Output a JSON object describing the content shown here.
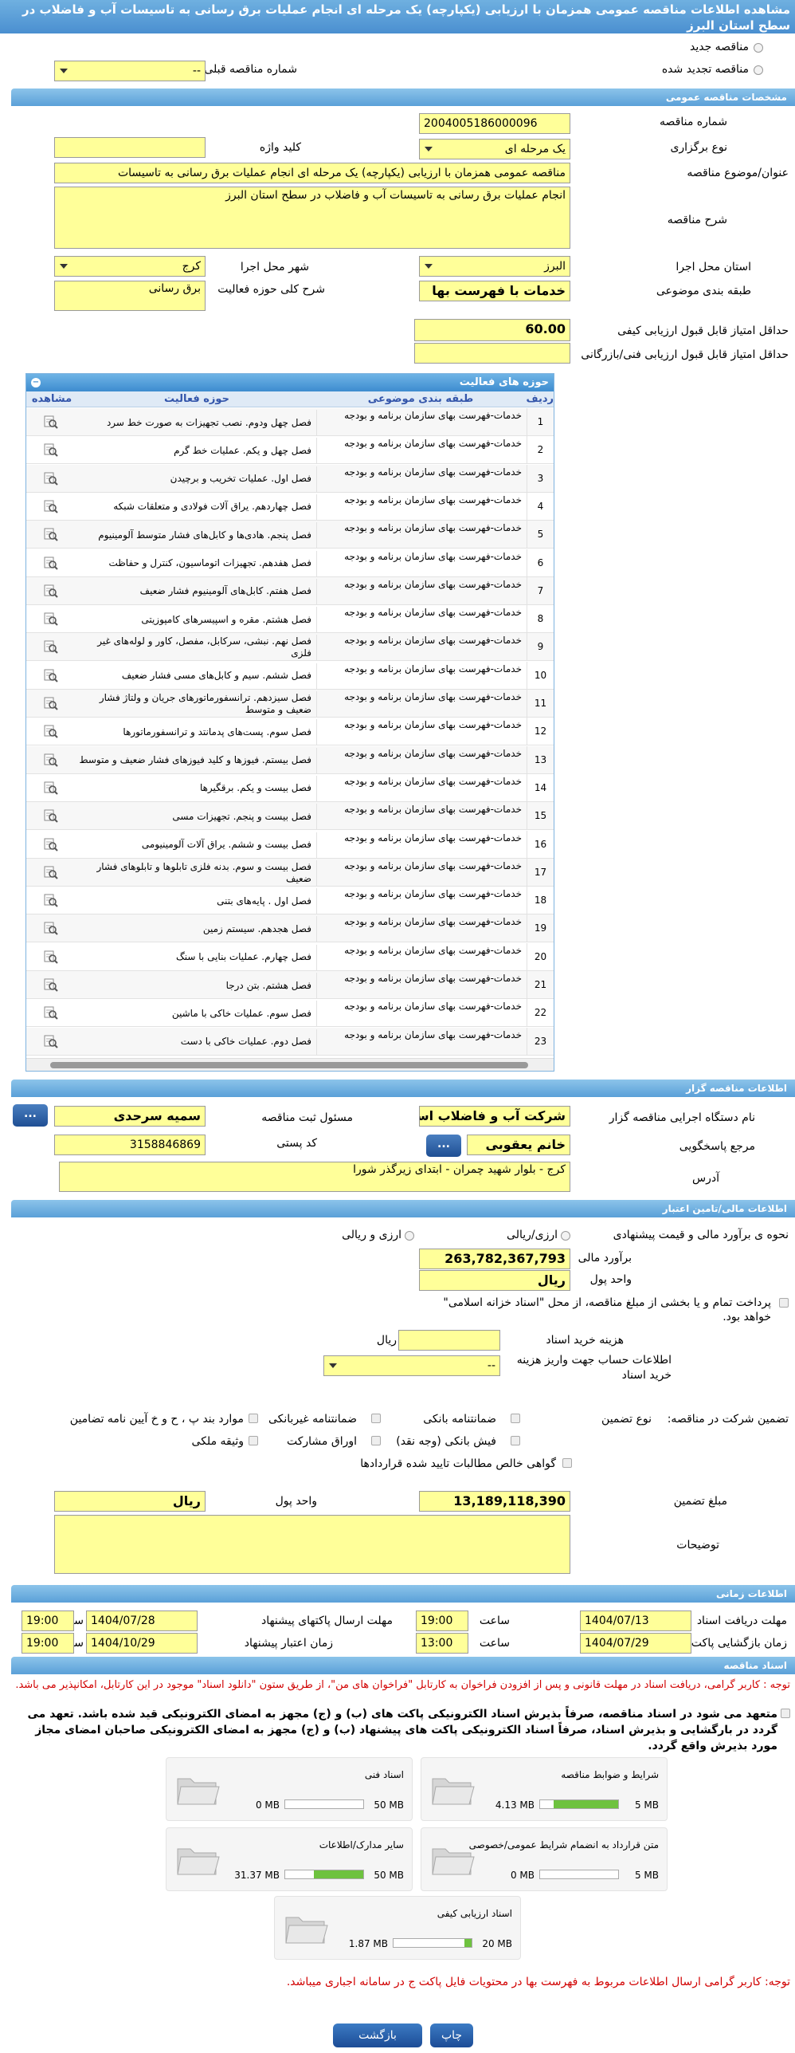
{
  "page": {
    "title": "مشاهده اطلاعات مناقصه عمومی همزمان با ارزیابی (یکپارچه) یک مرحله ای انجام عملیات برق رسانی به تاسیسات آب و فاضلاب در سطح استان البرز"
  },
  "tender_kind": {
    "new_label": "مناقصه جدید",
    "renewed_label": "مناقصه تجدید شده",
    "previous_number_label": "شماره مناقصه قبلی",
    "previous_number_value": "--"
  },
  "general": {
    "section_title": "مشخصات مناقصه عمومی",
    "number_label": "شماره مناقصه",
    "number_value": "2004005186000096",
    "type_label": "نوع برگزاری",
    "type_value": "یک مرحله ای",
    "keyword_label": "کلید واژه",
    "keyword_value": "",
    "subject_label": "عنوان/موضوع مناقصه",
    "subject_value": "مناقصه عمومی همزمان با ارزیابی (یکپارچه) یک مرحله ای انجام عملیات برق رسانی به تاسیسات",
    "description_label": "شرح مناقصه",
    "description_value": "انجام عملیات برق رسانی به تاسیسات آب و فاضلاب در سطح استان البرز",
    "province_label": "استان محل اجرا",
    "province_value": "البرز",
    "city_label": "شهر محل اجرا",
    "city_value": "کرج",
    "category_label": "طبقه بندی موضوعی",
    "category_value": "خدمات با فهرست بها",
    "scope_label": "شرح کلی حوزه فعالیت",
    "scope_value": "برق رسانی",
    "min_quality_label": "حداقل امتیاز قابل قبول ارزیابی کیفی",
    "min_quality_value": "60.00",
    "min_tech_label": "حداقل امتیاز قابل قبول ارزیابی فنی/بازرگانی",
    "min_tech_value": ""
  },
  "activity": {
    "title": "حوزه های فعالیت",
    "col_row": "ردیف",
    "col_category": "طبقه بندی موضوعی",
    "col_activity": "حوزه فعالیت",
    "col_view": "مشاهده",
    "category_text": "خدمات-فهرست بهای سازمان برنامه و بودجه",
    "rows": [
      {
        "n": "1",
        "act": "فصل چهل ودوم. نصب تجهیزات به صورت خط سرد"
      },
      {
        "n": "2",
        "act": "فصل چهل و یکم. عملیات خط گرم"
      },
      {
        "n": "3",
        "act": "فصل اول. عملیات تخریب و برچیدن"
      },
      {
        "n": "4",
        "act": "فصل چهاردهم. یراق آلات فولادی و متعلقات شبکه"
      },
      {
        "n": "5",
        "act": "فصل پنجم. هادی‌ها و کابل‌های فشار متوسط آلومینیوم"
      },
      {
        "n": "6",
        "act": "فصل هفدهم. تجهیزات اتوماسیون، کنترل و حفاظت"
      },
      {
        "n": "7",
        "act": "فصل هفتم. کابل‌های آلومینیوم فشار ضعیف"
      },
      {
        "n": "8",
        "act": "فصل هشتم. مقره و اسپیسرهای کامپوزیتی"
      },
      {
        "n": "9",
        "act": "فصل نهم. نبشی، سرکابل، مفصل، کاور و لوله‌های غیر فلزی"
      },
      {
        "n": "10",
        "act": "فصل ششم. سیم و کابل‌های مسی فشار ضعیف"
      },
      {
        "n": "11",
        "act": "فصل سیزدهم. ترانسفورماتورهای جریان و ولتاژ فشار ضعیف و متوسط"
      },
      {
        "n": "12",
        "act": "فصل سوم. پست‌های پدمانتد و ترانسفورماتورها"
      },
      {
        "n": "13",
        "act": "فصل بیستم. فیوزها و کلید فیوزهای فشار ضعیف و متوسط"
      },
      {
        "n": "14",
        "act": "فصل بیست و یکم. برقگیرها"
      },
      {
        "n": "15",
        "act": "فصل بیست و پنجم. تجهیزات مسی"
      },
      {
        "n": "16",
        "act": "فصل بیست و ششم. یراق آلات آلومینیومی"
      },
      {
        "n": "17",
        "act": "فصل بیست و سوم. بدنه فلزی تابلوها و تابلوهای فشار ضعیف"
      },
      {
        "n": "18",
        "act": "فصل اول . پایه‌های بتنی"
      },
      {
        "n": "19",
        "act": "فصل هجدهم. سیستم زمین"
      },
      {
        "n": "20",
        "act": "فصل چهارم. عملیات بنایی با سنگ"
      },
      {
        "n": "21",
        "act": "فصل هشتم. بتن درجا"
      },
      {
        "n": "22",
        "act": "فصل سوم. عملیات خاکی با ماشین"
      },
      {
        "n": "23",
        "act": "فصل دوم. عملیات خاکی با دست"
      }
    ]
  },
  "organizer": {
    "section_title": "اطلاعات مناقصه گزار",
    "org_label": "نام دستگاه اجرایی مناقصه گزار",
    "org_value": "شرکت آب و فاضلاب استان",
    "registrar_label": "مسئول ثبت مناقصه",
    "registrar_value": "سمیه سرحدی",
    "reference_label": "مرجع پاسخگویی",
    "reference_value": "خانم یعقوبی",
    "postal_label": "کد پستی",
    "postal_value": "3158846869",
    "address_label": "آدرس",
    "address_value": "کرج - بلوار شهید چمران - ابتدای زیرگذر شورا",
    "dots": "..."
  },
  "financial": {
    "section_title": "اطلاعات مالی/تامین اعتبار",
    "estimate_method_label": "نحوه ی برآورد مالی و قیمت پیشنهادی",
    "rial_label": "ارزی/ریالی",
    "fx_label": "ارزی و ریالی",
    "estimate_label": "برآورد مالی",
    "estimate_value": "263,782,367,793",
    "currency_label": "واحد پول",
    "currency_value": "ریال",
    "treasury_text": "پرداخت تمام و یا بخشی از مبلغ مناقصه، از محل \"اسناد خزانه اسلامی\" خواهد بود.",
    "doc_fee_label": "هزینه خرید اسناد",
    "doc_fee_value": "",
    "doc_fee_unit": "ریال",
    "account_label": "اطلاعات حساب جهت واریز هزینه خرید اسناد",
    "account_value": "--",
    "guarantee_label": "تضمین شرکت در مناقصه:",
    "guarantee_type_label": "نوع تضمین",
    "g1": "ضمانتنامه بانکی",
    "g2": "ضمانتنامه غیربانکی",
    "g3": "موارد بند پ ، ح و خ آیین نامه تضامین",
    "g4": "فیش بانکی (وجه نقد)",
    "g5": "اوراق مشارکت",
    "g6": "وثیقه ملکی",
    "g7": "گواهی خالص مطالبات تایید شده قراردادها",
    "amount_label": "مبلغ تضمین",
    "amount_value": "13,189,118,390",
    "amount_currency_label": "واحد پول",
    "amount_currency_value": "ریال",
    "notes_label": "توضیحات",
    "notes_value": ""
  },
  "timing": {
    "section_title": "اطلاعات زمانی",
    "receive_label": "مهلت دریافت اسناد",
    "receive_date": "1404/07/13",
    "receive_time": "19:00",
    "send_label": "مهلت ارسال پاکتهای پیشنهاد",
    "send_date": "1404/07/28",
    "send_time": "19:00",
    "open_label": "زمان بازگشایی پاکت ارزیابی کیفی",
    "open_date": "1404/07/29",
    "open_time": "13:00",
    "valid_label": "زمان اعتبار پیشنهاد",
    "valid_date": "1404/10/29",
    "valid_time": "19:00",
    "time_label": "ساعت"
  },
  "documents": {
    "section_title": "اسناد مناقصه",
    "note1": "توجه : کاربر گرامی، دریافت اسناد در مهلت قانونی و پس از افزودن فراخوان به کارتابل \"فراخوان های من\"، از طریق ستون \"دانلود اسناد\" موجود در این کارتابل، امکانپذیر می باشد.",
    "commit": "متعهد می شود در اسناد مناقصه، صرفاً بذیرش اسناد الکترونیکی پاکت های (ب) و (ج) مجهز به امضای الکترونیکی قید شده باشد. تعهد می گردد در بارگشایی و بذیرش اسناد، صرفاً اسناد الکترونیکی پاکت های پیشنهاد (ب) و (ج) مجهز به امضای الکترونیکی صاحبان امضای مجاز مورد بذیرش واقع گردد.",
    "files": [
      {
        "title": "شرایط و ضوابط مناقصه",
        "used": "4.13 MB",
        "size": "5 MB",
        "fill": 0.83
      },
      {
        "title": "اسناد فنی",
        "used": "0 MB",
        "size": "50 MB",
        "fill": 0
      },
      {
        "title": "متن قرارداد به انضمام شرایط عمومی/خصوصی",
        "used": "0 MB",
        "size": "5 MB",
        "fill": 0
      },
      {
        "title": "سایر مدارک/اطلاعات",
        "used": "31.37 MB",
        "size": "50 MB",
        "fill": 0.63
      },
      {
        "title": "اسناد ارزیابی کیفی",
        "used": "1.87 MB",
        "size": "20 MB",
        "fill": 0.09
      }
    ],
    "note2": "توجه: کاربر گرامی ارسال اطلاعات مربوط به فهرست بها در محتویات فایل پاکت ج در سامانه اجباری میباشد."
  },
  "actions": {
    "print_label": "چاپ",
    "back_label": "بازگشت"
  },
  "colors": {
    "field": "#ffff99",
    "header": "#4a8fd0",
    "alert": "#d10000"
  }
}
